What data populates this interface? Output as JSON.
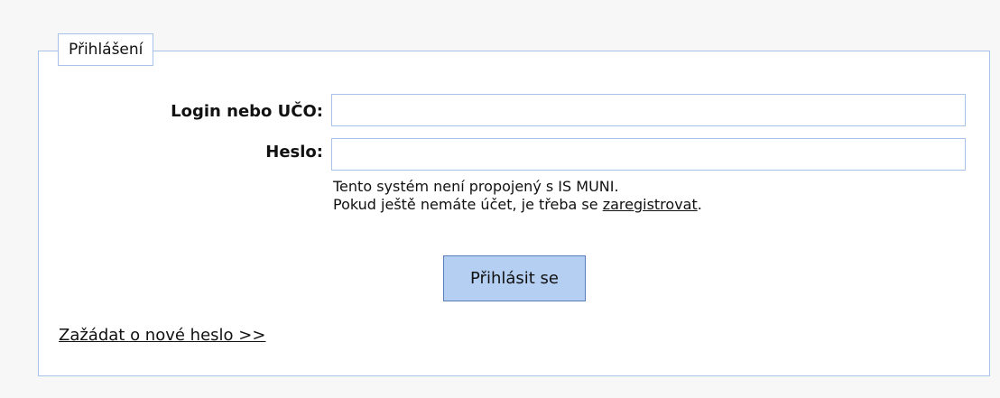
{
  "login_form": {
    "legend": "Přihlášení",
    "login_label": "Login nebo UČO:",
    "login_value": "",
    "password_label": "Heslo:",
    "password_value": "",
    "info_line1": "Tento systém není propojený s IS MUNI.",
    "info_line2_prefix": "Pokud ještě nemáte účet, je třeba se ",
    "register_link": "zaregistrovat",
    "info_line2_suffix": ".",
    "submit_label": "Přihlásit se",
    "reset_link": "Zažádat o nové heslo >>"
  },
  "colors": {
    "border": "#a7c4e8",
    "button_bg": "#b5cff3",
    "button_border": "#5a7fb8",
    "page_bg": "#f7f7f7"
  }
}
